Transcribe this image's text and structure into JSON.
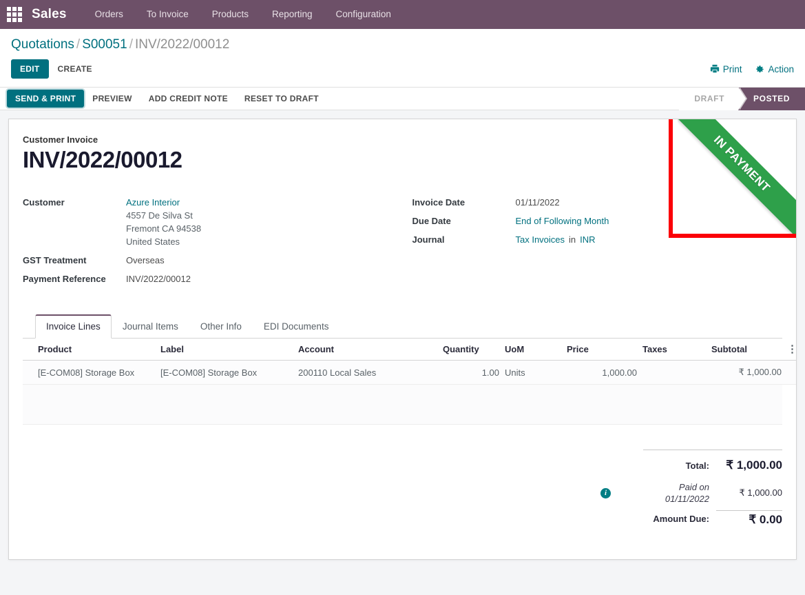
{
  "navbar": {
    "apps_icon": "apps-grid-icon",
    "brand": "Sales",
    "menu": [
      {
        "label": "Orders"
      },
      {
        "label": "To Invoice"
      },
      {
        "label": "Products"
      },
      {
        "label": "Reporting"
      },
      {
        "label": "Configuration"
      }
    ]
  },
  "breadcrumb": {
    "root": "Quotations",
    "sep1": "/",
    "parent": "S00051",
    "sep2": "/",
    "current": "INV/2022/00012"
  },
  "control_panel": {
    "edit_label": "EDIT",
    "create_label": "CREATE",
    "print_label": "Print",
    "print_icon": "printer-icon",
    "action_label": "Action",
    "action_icon": "gear-icon"
  },
  "statusbar": {
    "buttons": [
      {
        "label": "SEND & PRINT",
        "primary": true
      },
      {
        "label": "PREVIEW",
        "primary": false
      },
      {
        "label": "ADD CREDIT NOTE",
        "primary": false
      },
      {
        "label": "RESET TO DRAFT",
        "primary": false
      }
    ],
    "stages": [
      {
        "label": "DRAFT",
        "current": false
      },
      {
        "label": "POSTED",
        "current": true
      }
    ]
  },
  "ribbon": {
    "text": "IN PAYMENT",
    "color": "#2ea04a",
    "highlight_color": "#fb0007"
  },
  "sheet": {
    "subtitle": "Customer Invoice",
    "title": "INV/2022/00012",
    "left_fields": [
      {
        "label": "Customer",
        "value": "Azure Interior",
        "is_link": true,
        "address": [
          "4557 De Silva St",
          "Fremont CA 94538",
          "United States"
        ]
      },
      {
        "label": "GST Treatment",
        "value": "Overseas",
        "is_link": false
      },
      {
        "label": "Payment Reference",
        "value": "INV/2022/00012",
        "is_link": false
      }
    ],
    "right_fields": [
      {
        "label": "Invoice Date",
        "value": "01/11/2022",
        "is_link": false
      },
      {
        "label": "Due Date",
        "value": "End of Following Month",
        "is_link": true
      },
      {
        "label": "Journal",
        "value": "Tax Invoices",
        "is_link": true,
        "separator": "in",
        "value2": "INR",
        "value2_is_link": true
      }
    ]
  },
  "notebook": {
    "tabs": [
      {
        "label": "Invoice Lines",
        "active": true
      },
      {
        "label": "Journal Items",
        "active": false
      },
      {
        "label": "Other Info",
        "active": false
      },
      {
        "label": "EDI Documents",
        "active": false
      }
    ],
    "columns": [
      "Product",
      "Label",
      "Account",
      "Quantity",
      "UoM",
      "Price",
      "Taxes",
      "Subtotal"
    ],
    "optional_columns_icon": "vertical-dots-icon",
    "rows": [
      {
        "product": "[E-COM08] Storage Box",
        "label": "[E-COM08] Storage Box",
        "account": "200110 Local Sales",
        "quantity": "1.00",
        "uom": "Units",
        "price": "1,000.00",
        "taxes": "",
        "subtotal": "₹ 1,000.00"
      }
    ]
  },
  "totals": {
    "total_label": "Total:",
    "total_value": "₹ 1,000.00",
    "info_icon": "info-icon",
    "paid_label_line1": "Paid on",
    "paid_label_line2": "01/11/2022",
    "paid_value": "₹ 1,000.00",
    "amount_due_label": "Amount Due:",
    "amount_due_value": "₹ 0.00"
  }
}
